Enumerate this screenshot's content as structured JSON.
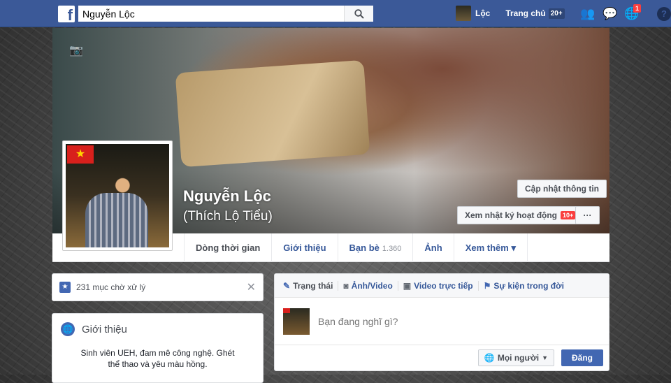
{
  "topbar": {
    "logo": "f",
    "search_value": "Nguyễn Lộc",
    "user": "Lộc",
    "home": "Trang chủ",
    "home_count": "20+",
    "notif_count": "1"
  },
  "profile": {
    "name": "Nguyễn Lộc",
    "nickname": "(Thích Lộ Tiểu)",
    "update_info": "Cập nhật thông tin",
    "activity_log": "Xem nhật ký hoạt động",
    "activity_count": "10+",
    "more": "···"
  },
  "tabs": [
    {
      "label": "Dòng thời gian"
    },
    {
      "label": "Giới thiệu"
    },
    {
      "label": "Bạn bè",
      "count": "1.360"
    },
    {
      "label": "Ảnh"
    },
    {
      "label": "Xem thêm ▾"
    }
  ],
  "pending": {
    "text": "231 mục chờ xử lý"
  },
  "intro": {
    "title": "Giới thiệu",
    "bio": "Sinh viên UEH, đam mê công nghệ. Ghét thể thao và yêu màu hồng."
  },
  "composer": {
    "tabs": [
      "Trạng thái",
      "Ảnh/Video",
      "Video trực tiếp",
      "Sự kiện trong đời"
    ],
    "placeholder": "Bạn đang nghĩ gì?",
    "audience": "Mọi người",
    "post": "Đăng"
  }
}
